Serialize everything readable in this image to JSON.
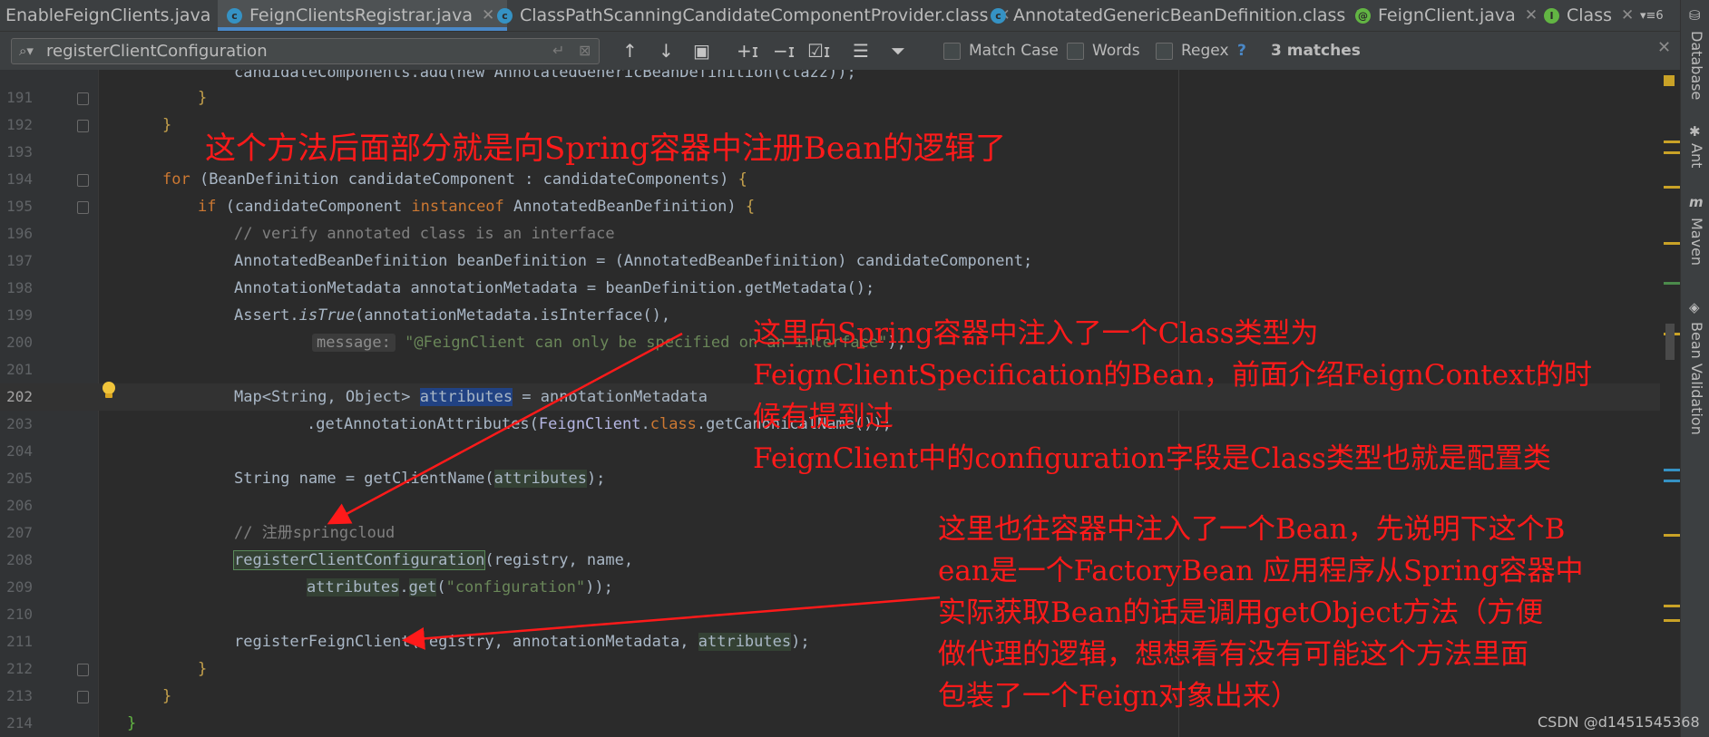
{
  "tabs": [
    {
      "label": "EnableFeignClients.java",
      "icon": "none",
      "active": false
    },
    {
      "label": "FeignClientsRegistrar.java",
      "icon": "class-icon",
      "active": true
    },
    {
      "label": "ClassPathScanningCandidateComponentProvider.class",
      "icon": "class-icon",
      "active": false
    },
    {
      "label": "AnnotatedGenericBeanDefinition.class",
      "icon": "class-icon",
      "active": false
    },
    {
      "label": "FeignClient.java",
      "icon": "annotation-icon",
      "active": false
    },
    {
      "label": "Class",
      "icon": "interface-icon",
      "active": false
    }
  ],
  "tab_overflow_count": "6",
  "find": {
    "query": "registerClientConfiguration",
    "options": {
      "match_case": "Match Case",
      "words": "Words",
      "regex": "Regex"
    },
    "help": "?",
    "matches": "3 matches"
  },
  "code_lines": [
    {
      "num": "191"
    },
    {
      "num": "192"
    },
    {
      "num": "193"
    },
    {
      "num": "194"
    },
    {
      "num": "195"
    },
    {
      "num": "196"
    },
    {
      "num": "197"
    },
    {
      "num": "198"
    },
    {
      "num": "199"
    },
    {
      "num": "200"
    },
    {
      "num": "201"
    },
    {
      "num": "202"
    },
    {
      "num": "203"
    },
    {
      "num": "204"
    },
    {
      "num": "205"
    },
    {
      "num": "206"
    },
    {
      "num": "207"
    },
    {
      "num": "208"
    },
    {
      "num": "209"
    },
    {
      "num": "210"
    },
    {
      "num": "211"
    },
    {
      "num": "212"
    },
    {
      "num": "213"
    },
    {
      "num": "214"
    }
  ],
  "code": {
    "l0": "candidateComponents.add(new AnnotatedGenericBeanDefinition(clazz));",
    "l194_kw": "for",
    "l194_a": " (BeanDefinition candidateComponent : candidateComponents) ",
    "l195_kw": "if",
    "l195_a": " (candidateComponent ",
    "l195_kw2": "instanceof",
    "l195_b": " AnnotatedBeanDefinition) ",
    "l196": "// verify annotated class is an interface",
    "l197": "AnnotatedBeanDefinition beanDefinition = (AnnotatedBeanDefinition) candidateComponent;",
    "l198": "AnnotationMetadata annotationMetadata = beanDefinition.getMetadata();",
    "l199_a": "Assert.",
    "l199_b": "isTrue",
    "l199_c": "(annotationMetadata.isInterface(),",
    "l200_hint": "message:",
    "l200_str": "\"@FeignClient can only be specified on an interface\"",
    "l200_end": ");",
    "l202_a": "Map<String, Object> ",
    "l202_sel": "attributes",
    "l202_b": " = annotationMetadata",
    "l203_a": ".getAnnotationAttributes(",
    "l203_b": "FeignClient",
    "l203_c": ".",
    "l203_kw": "class",
    "l203_d": ".getCanonicalName());",
    "l205_a": "String name = getClientName(",
    "l205_hl": "attributes",
    "l205_b": ");",
    "l207": "// 注册springcloud",
    "l208_hl": "registerClientConfiguration",
    "l208_b": "(registry, name,",
    "l209_hl": "attributes",
    "l209_a": ".",
    "l209_hl2": "get",
    "l209_b": "(",
    "l209_str": "\"configuration\"",
    "l209_c": "));",
    "l211_a": "registerFeignClient(registry, annotationMetadata, ",
    "l211_hl": "attributes",
    "l211_b": ");",
    "brace_open": "{",
    "brace_close": "}"
  },
  "annotations": {
    "a1": "这个方法后面部分就是向Spring容器中注册Bean的逻辑了",
    "a2": [
      "这里向Spring容器中注入了一个Class类型为",
      "FeignClientSpecification的Bean，前面介绍FeignContext的时",
      "候有提到过",
      "FeignClient中的configuration字段是Class类型也就是配置类"
    ],
    "a3": [
      "这里也往容器中注入了一个Bean，先说明下这个B",
      "ean是一个FactoryBean 应用程序从Spring容器中",
      "实际获取Bean的话是调用getObject方法（方便",
      "做代理的逻辑，想想看有没有可能这个方法里面",
      "包装了一个Feign对象出来）"
    ]
  },
  "right_panel": [
    "Database",
    "Ant",
    "Maven",
    "Bean Validation"
  ],
  "watermark": "CSDN @d1451545368",
  "colors": {
    "annotation_red": "#ff1a1a",
    "accent_blue": "#4a88c7",
    "keyword": "#cc7832",
    "string": "#6a8759",
    "comment": "#808080"
  }
}
